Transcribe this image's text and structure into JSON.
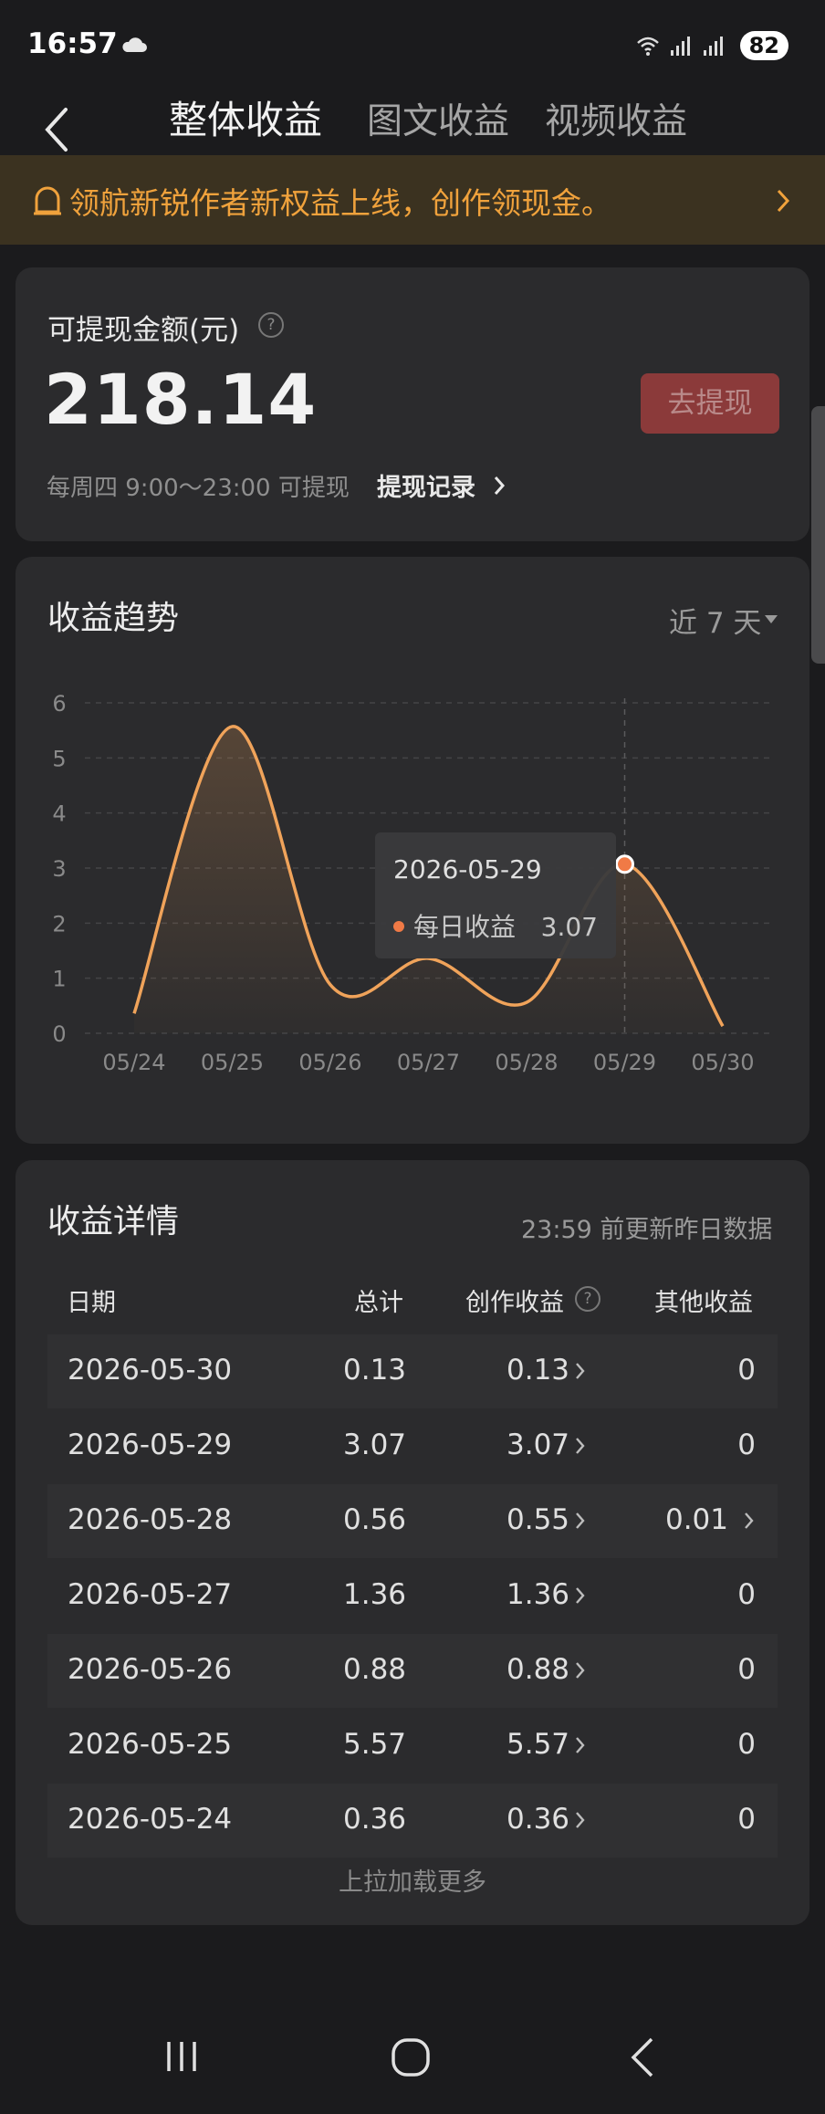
{
  "status_bar": {
    "time": "16:57",
    "battery": "82"
  },
  "header": {
    "tabs": [
      {
        "label": "整体收益",
        "active": true
      },
      {
        "label": "图文收益",
        "active": false
      },
      {
        "label": "视频收益",
        "active": false
      }
    ]
  },
  "banner": {
    "text": "领航新锐作者新权益上线，创作领现金。"
  },
  "withdraw": {
    "label": "可提现金额(元)",
    "amount": "218.14",
    "button": "去提现",
    "note": "每周四 9:00～23:00 可提现",
    "record_link": "提现记录"
  },
  "trend": {
    "title": "收益趋势",
    "range": "近 7 天",
    "tooltip": {
      "date": "2026-05-29",
      "label": "每日收益",
      "value": "3.07"
    }
  },
  "chart_data": {
    "type": "area",
    "categories": [
      "05/24",
      "05/25",
      "05/26",
      "05/27",
      "05/28",
      "05/29",
      "05/30"
    ],
    "values": [
      0.36,
      5.57,
      0.88,
      1.36,
      0.56,
      3.07,
      0.13
    ],
    "ylim": [
      0,
      6
    ],
    "yticks": [
      "0",
      "1",
      "2",
      "3",
      "4",
      "5",
      "6"
    ],
    "grid": true,
    "highlight_index": 5,
    "colors": {
      "line": "#f0a35a",
      "point": "#f07a46",
      "grid": "#444446"
    }
  },
  "details": {
    "title": "收益详情",
    "update_note": "23:59 前更新昨日数据",
    "columns": [
      "日期",
      "总计",
      "创作收益",
      "其他收益"
    ],
    "rows": [
      {
        "date": "2026-05-30",
        "total": "0.13",
        "creation": "0.13",
        "other": "0"
      },
      {
        "date": "2026-05-29",
        "total": "3.07",
        "creation": "3.07",
        "other": "0"
      },
      {
        "date": "2026-05-28",
        "total": "0.56",
        "creation": "0.55",
        "other": "0.01"
      },
      {
        "date": "2026-05-27",
        "total": "1.36",
        "creation": "1.36",
        "other": "0"
      },
      {
        "date": "2026-05-26",
        "total": "0.88",
        "creation": "0.88",
        "other": "0"
      },
      {
        "date": "2026-05-25",
        "total": "5.57",
        "creation": "5.57",
        "other": "0"
      },
      {
        "date": "2026-05-24",
        "total": "0.36",
        "creation": "0.36",
        "other": "0"
      }
    ],
    "load_more": "上拉加载更多"
  },
  "colors": {
    "background": "#1b1b1d",
    "card": "#2b2b2d",
    "accent": "#f0a23c",
    "button": "#8b3a3a"
  }
}
